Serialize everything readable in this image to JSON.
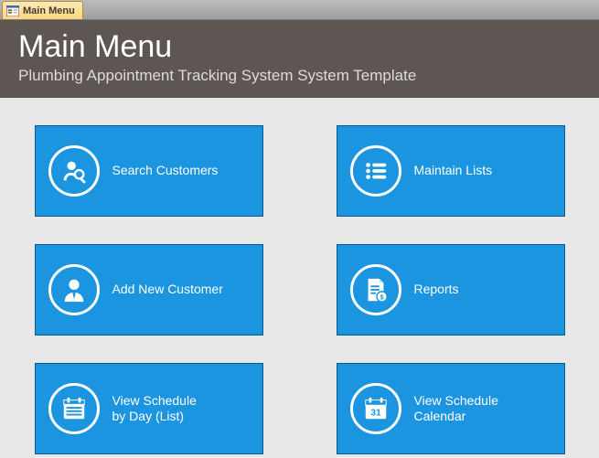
{
  "tab": {
    "label": "Main Menu"
  },
  "header": {
    "title": "Main Menu",
    "subtitle": "Plumbing Appointment Tracking System System Template"
  },
  "tiles": {
    "search_customers": "Search Customers",
    "maintain_lists": "Maintain Lists",
    "add_new_customer": "Add New Customer",
    "reports": "Reports",
    "view_schedule_day": "View Schedule\nby Day (List)",
    "view_schedule_calendar": "View Schedule\nCalendar"
  }
}
